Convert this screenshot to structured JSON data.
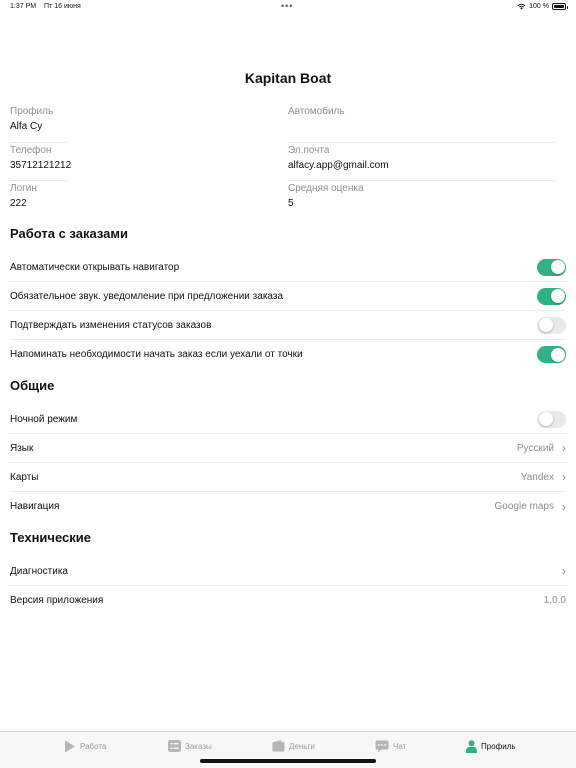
{
  "status_bar": {
    "time": "1:37 PM",
    "date": "Пт 16 июня",
    "dots": "•••",
    "battery": "100 %"
  },
  "page": {
    "title": "Kapitan Boat"
  },
  "profile": {
    "fields": [
      {
        "label": "Профиль",
        "value": "Alfa Cy"
      },
      {
        "label": "Автомобиль",
        "value": ""
      },
      {
        "label": "Телефон",
        "value": "35712121212"
      },
      {
        "label": "Эл.почта",
        "value": "alfacy.app@gmail.com"
      },
      {
        "label": "Логин",
        "value": "222"
      },
      {
        "label": "Средняя оценка",
        "value": "5"
      }
    ]
  },
  "orders_section": {
    "title": "Работа с заказами",
    "items": [
      {
        "label": "Автоматически открывать навигатор",
        "on": true
      },
      {
        "label": "Обязательное звук. уведомление при предложении заказа",
        "on": true
      },
      {
        "label": "Подтверждать изменения статусов заказов",
        "on": false
      },
      {
        "label": "Напоминать необходимости начать заказ если уехали от точки",
        "on": true
      }
    ]
  },
  "general_section": {
    "title": "Общие",
    "night_mode": {
      "label": "Ночной режим",
      "on": false
    },
    "language": {
      "label": "Язык",
      "value": "Русский"
    },
    "maps": {
      "label": "Карты",
      "value": "Yandex"
    },
    "navigation": {
      "label": "Навигация",
      "value": "Google maps"
    }
  },
  "tech_section": {
    "title": "Технические",
    "diagnostics": {
      "label": "Диагностика"
    },
    "version": {
      "label": "Версия приложения",
      "value": "1.0.0"
    }
  },
  "tabs": [
    {
      "label": "Работа",
      "icon": "play-icon",
      "active": false
    },
    {
      "label": "Заказы",
      "icon": "list-icon",
      "active": false
    },
    {
      "label": "Деньги",
      "icon": "wallet-icon",
      "active": false
    },
    {
      "label": "Чат",
      "icon": "chat-icon",
      "active": false
    },
    {
      "label": "Профиль",
      "icon": "person-icon",
      "active": true
    }
  ],
  "colors": {
    "accent": "#2fb383",
    "toggle_off": "#e9e9eb",
    "secondary_text": "#8e8e93"
  }
}
